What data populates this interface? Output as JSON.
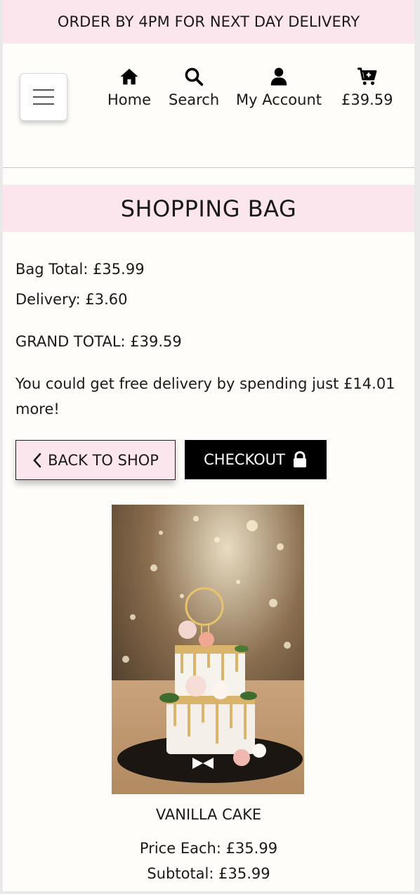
{
  "banner": {
    "text": "ORDER BY 4PM FOR NEXT DAY DELIVERY"
  },
  "nav": {
    "items": [
      {
        "label": "Home",
        "icon": "home-icon"
      },
      {
        "label": "Search",
        "icon": "search-icon"
      },
      {
        "label": "My Account",
        "icon": "user-icon"
      },
      {
        "label": "£39.59",
        "icon": "cart-plus-icon"
      }
    ]
  },
  "page_title": "SHOPPING BAG",
  "summary": {
    "bag_total": "Bag Total: £35.99",
    "delivery": "Delivery: £3.60",
    "grand_total": "GRAND TOTAL: £39.59",
    "free_delivery_line1": "You could get free delivery by spending just £14.01",
    "free_delivery_line2": "more!"
  },
  "buttons": {
    "back_to_shop": "BACK TO SHOP",
    "checkout": "CHECKOUT"
  },
  "product": {
    "name": "VANILLA CAKE",
    "price_each": "Price Each: £35.99",
    "subtotal": "Subtotal: £35.99",
    "image_alt": "cake-image"
  },
  "colors": {
    "accent_pink": "#fbe6ee",
    "checkout_bg": "#000000",
    "page_bg": "#fffdf9"
  }
}
